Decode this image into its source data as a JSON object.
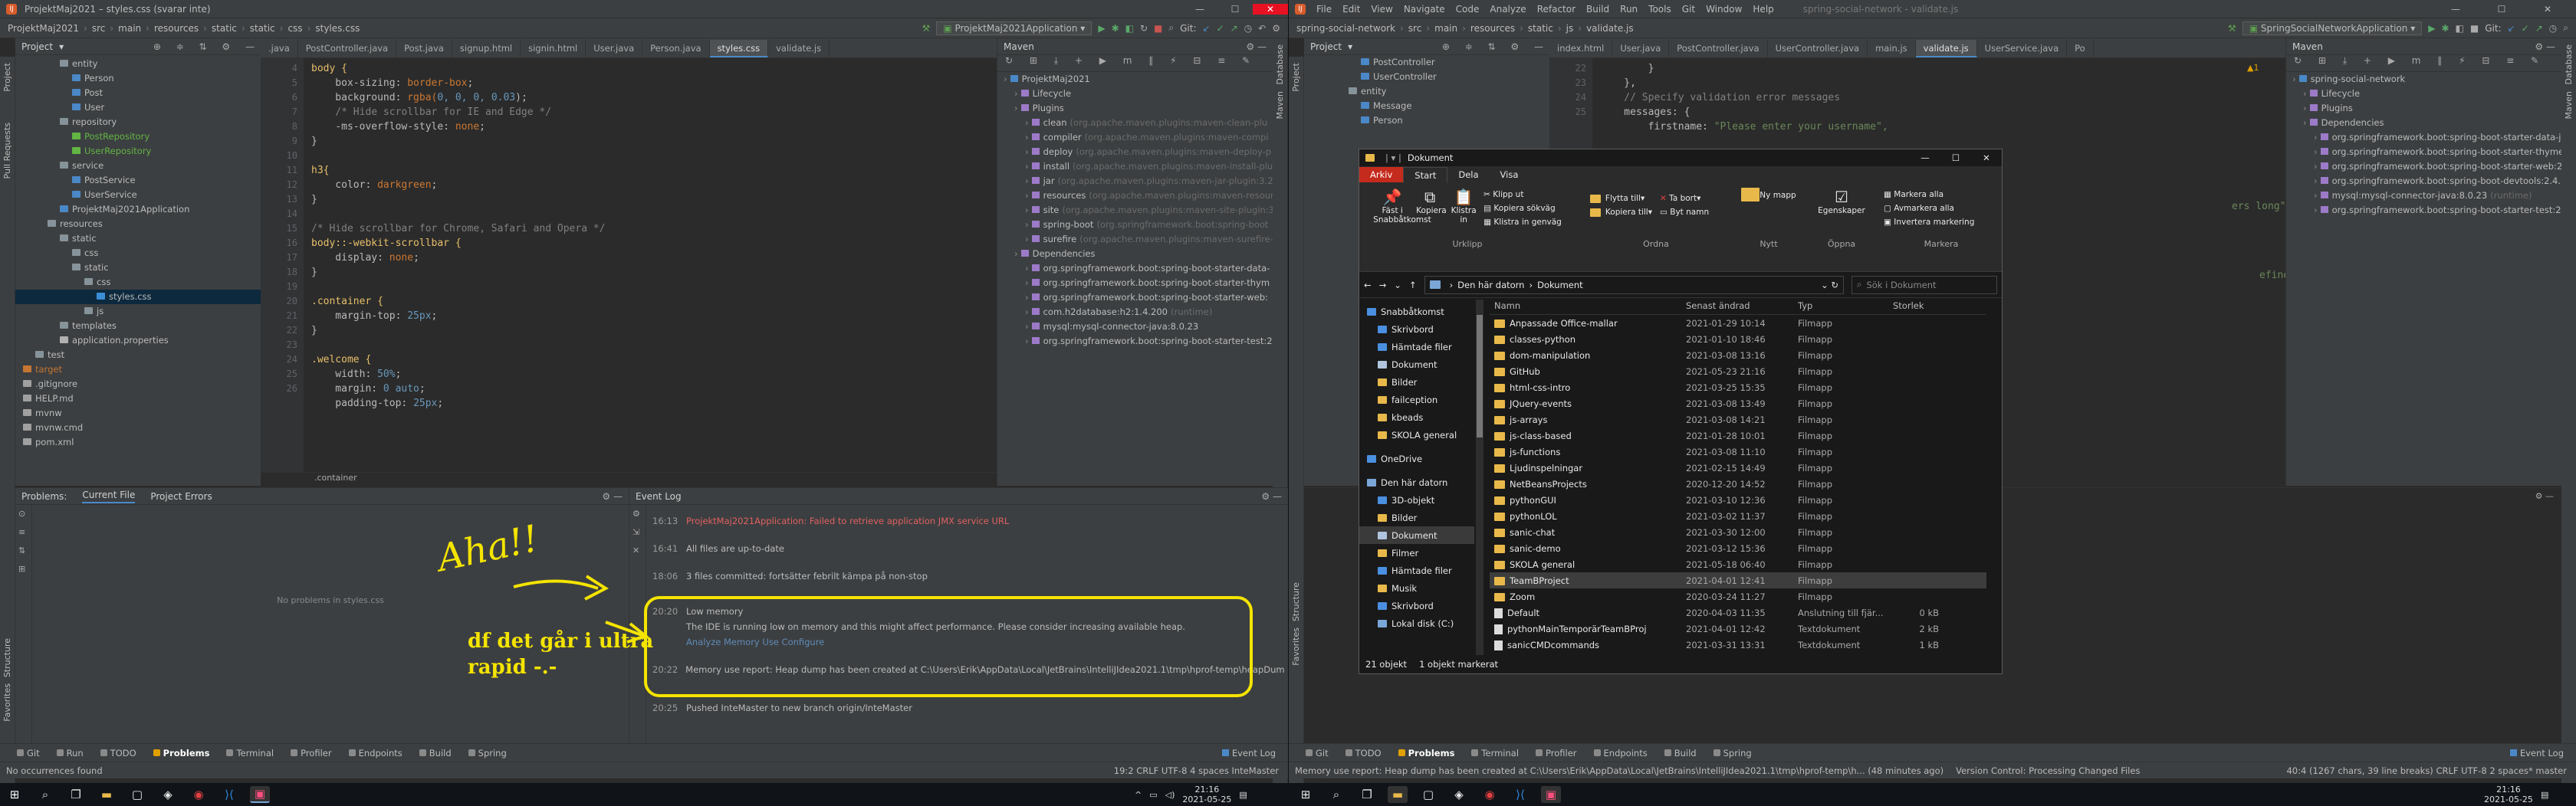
{
  "left_ide": {
    "title": "ProjektMaj2021 – styles.css (svarar inte)",
    "menu": [
      "File",
      "Edit",
      "View",
      "Navigate",
      "Code",
      "Analyze",
      "Refactor",
      "Build",
      "Run",
      "Tools",
      "Git",
      "Window",
      "Help"
    ],
    "breadcrumb": [
      "ProjektMaj2021",
      "src",
      "main",
      "resources",
      "static",
      "static",
      "css",
      "styles.css"
    ],
    "run_config": "ProjektMaj2021Application",
    "git_label": "Git:",
    "tabs": [
      ".java",
      "PostController.java",
      "Post.java",
      "signup.html",
      "signin.html",
      "User.java",
      "Person.java",
      "styles.css",
      "validate.js"
    ],
    "project_label": "Project",
    "tree": [
      {
        "t": "entity",
        "lvl": 3,
        "k": "folder"
      },
      {
        "t": "Person",
        "lvl": 4,
        "k": "class"
      },
      {
        "t": "Post",
        "lvl": 4,
        "k": "class"
      },
      {
        "t": "User",
        "lvl": 4,
        "k": "class"
      },
      {
        "t": "repository",
        "lvl": 3,
        "k": "folder"
      },
      {
        "t": "PostRepository",
        "lvl": 4,
        "k": "iface"
      },
      {
        "t": "UserRepository",
        "lvl": 4,
        "k": "iface"
      },
      {
        "t": "service",
        "lvl": 3,
        "k": "folder"
      },
      {
        "t": "PostService",
        "lvl": 4,
        "k": "class"
      },
      {
        "t": "UserService",
        "lvl": 4,
        "k": "class"
      },
      {
        "t": "ProjektMaj2021Application",
        "lvl": 3,
        "k": "class"
      },
      {
        "t": "resources",
        "lvl": 2,
        "k": "folder"
      },
      {
        "t": "static",
        "lvl": 3,
        "k": "folder"
      },
      {
        "t": "css",
        "lvl": 4,
        "k": "folder"
      },
      {
        "t": "static",
        "lvl": 4,
        "k": "folder"
      },
      {
        "t": "css",
        "lvl": 5,
        "k": "folder"
      },
      {
        "t": "styles.css",
        "lvl": 6,
        "k": "css"
      },
      {
        "t": "js",
        "lvl": 5,
        "k": "folder"
      },
      {
        "t": "templates",
        "lvl": 3,
        "k": "folder"
      },
      {
        "t": "application.properties",
        "lvl": 3,
        "k": "prop"
      },
      {
        "t": "test",
        "lvl": 1,
        "k": "folder"
      },
      {
        "t": "target",
        "lvl": 0,
        "k": "folder-ex"
      },
      {
        "t": ".gitignore",
        "lvl": 0,
        "k": "file"
      },
      {
        "t": "HELP.md",
        "lvl": 0,
        "k": "file"
      },
      {
        "t": "mvnw",
        "lvl": 0,
        "k": "file"
      },
      {
        "t": "mvnw.cmd",
        "lvl": 0,
        "k": "file"
      },
      {
        "t": "pom.xml",
        "lvl": 0,
        "k": "file"
      }
    ],
    "gutter": [
      "4",
      "5",
      "6",
      "7",
      "8",
      "9",
      "10",
      "11",
      "12",
      "13",
      "14",
      "15",
      "16",
      "17",
      "18",
      "19",
      "20",
      "21",
      "22",
      "23",
      "24",
      "25",
      "26"
    ],
    "code_lines": [
      [
        [
          "body {",
          "sel"
        ]
      ],
      [
        [
          "    box-sizing: ",
          "p"
        ],
        [
          "border-box",
          "k"
        ],
        [
          ";",
          "p"
        ]
      ],
      [
        [
          "    background: ",
          "p"
        ],
        [
          "rgba(",
          "k"
        ],
        [
          "0, 0, 0, 0.03",
          "n"
        ],
        [
          ");",
          "p"
        ]
      ],
      [
        [
          "    /* Hide scrollbar for IE and Edge */",
          "c"
        ]
      ],
      [
        [
          "    -ms-overflow-style: ",
          "p"
        ],
        [
          "none",
          "k"
        ],
        [
          ";",
          "p"
        ]
      ],
      [
        [
          "}",
          "p"
        ]
      ],
      [
        [
          "",
          "p"
        ]
      ],
      [
        [
          "h3{",
          "sel"
        ]
      ],
      [
        [
          "    color: ",
          "p"
        ],
        [
          "darkgreen",
          "k"
        ],
        [
          ";",
          "p"
        ]
      ],
      [
        [
          "}",
          "p"
        ]
      ],
      [
        [
          "",
          "p"
        ]
      ],
      [
        [
          "/* Hide scrollbar for Chrome, Safari and Opera */",
          "c"
        ]
      ],
      [
        [
          "body::-webkit-scrollbar {",
          "sel"
        ]
      ],
      [
        [
          "    display: ",
          "p"
        ],
        [
          "none",
          "k"
        ],
        [
          ";",
          "p"
        ]
      ],
      [
        [
          "}",
          "p"
        ]
      ],
      [
        [
          "",
          "p"
        ]
      ],
      [
        [
          ".container {",
          "sel"
        ]
      ],
      [
        [
          "    margin-top: ",
          "p"
        ],
        [
          "25px",
          "n"
        ],
        [
          ";",
          "p"
        ]
      ],
      [
        [
          "}",
          "p"
        ]
      ],
      [
        [
          "",
          "p"
        ]
      ],
      [
        [
          ".welcome {",
          "sel"
        ]
      ],
      [
        [
          "    width: ",
          "p"
        ],
        [
          "50%",
          "n"
        ],
        [
          ";",
          "p"
        ]
      ],
      [
        [
          "    margin: ",
          "p"
        ],
        [
          "0 auto",
          "n"
        ],
        [
          ";",
          "p"
        ]
      ],
      [
        [
          "    padding-top: ",
          "p"
        ],
        [
          "25px",
          "n"
        ],
        [
          ";",
          "p"
        ]
      ]
    ],
    "editor_crumb": ".container",
    "maven_label": "Maven",
    "maven_tree": [
      {
        "t": "ProjektMaj2021",
        "lvl": 0
      },
      {
        "t": "Lifecycle",
        "lvl": 1
      },
      {
        "t": "Plugins",
        "lvl": 1
      },
      {
        "t": "clean",
        "d": "(org.apache.maven.plugins:maven-clean-plu",
        "lvl": 2
      },
      {
        "t": "compiler",
        "d": "(org.apache.maven.plugins:maven-compi",
        "lvl": 2
      },
      {
        "t": "deploy",
        "d": "(org.apache.maven.plugins:maven-deploy-p",
        "lvl": 2
      },
      {
        "t": "install",
        "d": "(org.apache.maven.plugins:maven-install-plu",
        "lvl": 2
      },
      {
        "t": "jar",
        "d": "(org.apache.maven.plugins:maven-jar-plugin:3.2",
        "lvl": 2
      },
      {
        "t": "resources",
        "d": "(org.apache.maven.plugins:maven-resour",
        "lvl": 2
      },
      {
        "t": "site",
        "d": "(org.apache.maven.plugins:maven-site-plugin:3",
        "lvl": 2
      },
      {
        "t": "spring-boot",
        "d": "(org.springframework.boot:spring-boot",
        "lvl": 2
      },
      {
        "t": "surefire",
        "d": "(org.apache.maven.plugins:maven-surefire-",
        "lvl": 2
      },
      {
        "t": "Dependencies",
        "lvl": 1
      },
      {
        "t": "org.springframework.boot:spring-boot-starter-data-",
        "lvl": 2
      },
      {
        "t": "org.springframework.boot:spring-boot-starter-thym",
        "lvl": 2
      },
      {
        "t": "org.springframework.boot:spring-boot-starter-web:",
        "lvl": 2
      },
      {
        "t": "com.h2database:h2:1.4.200",
        "d": "(runtime)",
        "lvl": 2
      },
      {
        "t": "mysql:mysql-connector-java:8.0.23",
        "lvl": 2
      },
      {
        "t": "org.springframework.boot:spring-boot-starter-test:2",
        "lvl": 2
      }
    ],
    "problems_tabs": [
      "Problems:",
      "Current File",
      "Project Errors"
    ],
    "problems_empty": "No problems in styles.css",
    "event_log_label": "Event Log",
    "events": [
      {
        "time": "16:13",
        "text": "ProjektMaj2021Application: Failed to retrieve application JMX service URL",
        "err": true
      },
      {
        "time": "16:41",
        "text": "All files are up-to-date",
        "err": false
      },
      {
        "time": "18:06",
        "text": "3 files committed: fortsätter febrilt kämpa på non-stop",
        "err": false
      },
      {
        "time": "20:20",
        "text": "Low memory",
        "err": false
      },
      {
        "time": "",
        "text": "The IDE is running low on memory and this might affect performance. Please consider increasing available heap.",
        "err": false
      },
      {
        "time": "",
        "text": "Analyze Memory Use   Configure",
        "err": false,
        "link": true
      },
      {
        "time": "20:22",
        "text": "Memory use report: Heap dump has been created at C:\\Users\\Erik\\AppData\\Local\\JetBrains\\IntelliJIdea2021.1\\tmp\\hprof-temp\\heapDump-idea",
        "err": false
      },
      {
        "time": "20:25",
        "text": "Pushed InteMaster to new branch origin/InteMaster",
        "err": false
      }
    ],
    "toolwin": [
      "Git",
      "Run",
      "TODO",
      "Problems",
      "Terminal",
      "Profiler",
      "Endpoints",
      "Build",
      "Spring"
    ],
    "toolwin_right": "Event Log",
    "status_left": "No occurrences found",
    "status_right": "19:2  CRLF  UTF-8  4 spaces  InteMaster"
  },
  "annotation": {
    "aha": "Aha!!",
    "line1": "df det går i ultra",
    "line2": "rapid -.-"
  },
  "right_ide": {
    "menu": [
      "File",
      "Edit",
      "View",
      "Navigate",
      "Code",
      "Analyze",
      "Refactor",
      "Build",
      "Run",
      "Tools",
      "Git",
      "Window",
      "Help"
    ],
    "title_ghost": "spring-social-network - validate.js",
    "breadcrumb": [
      "spring-social-network",
      "src",
      "main",
      "resources",
      "static",
      "js",
      "validate.js"
    ],
    "run_config": "SpringSocialNetworkApplication",
    "git_label": "Git:",
    "tabs": [
      "index.html",
      "User.java",
      "PostController.java",
      "UserController.java",
      "main.js",
      "validate.js",
      "UserService.java",
      "Po"
    ],
    "tree": [
      {
        "t": "PostController",
        "lvl": 4,
        "k": "class"
      },
      {
        "t": "UserController",
        "lvl": 4,
        "k": "class"
      },
      {
        "t": "entity",
        "lvl": 3,
        "k": "folder"
      },
      {
        "t": "Message",
        "lvl": 4,
        "k": "class"
      },
      {
        "t": "Person",
        "lvl": 4,
        "k": "class"
      }
    ],
    "gutter": [
      "22",
      "23",
      "24",
      "25"
    ],
    "code_lines": [
      [
        [
          "        }",
          "p"
        ]
      ],
      [
        [
          "    },",
          "p"
        ]
      ],
      [
        [
          "    // Specify validation error messages",
          "c"
        ]
      ],
      [
        [
          "    messages: {",
          "p"
        ]
      ],
      [
        [
          "        firstname: ",
          "p"
        ],
        [
          "\"Please enter your username\",",
          "s"
        ]
      ]
    ],
    "peek1": "ers long\"",
    "peek2": "efined",
    "warn": "▲1",
    "maven_label": "Maven",
    "maven_tree": [
      {
        "t": "spring-social-network",
        "lvl": 0
      },
      {
        "t": "Lifecycle",
        "lvl": 1
      },
      {
        "t": "Plugins",
        "lvl": 1
      },
      {
        "t": "Dependencies",
        "lvl": 1
      },
      {
        "t": "org.springframework.boot:spring-boot-starter-data-jp",
        "lvl": 2
      },
      {
        "t": "org.springframework.boot:spring-boot-starter-thymel",
        "lvl": 2
      },
      {
        "t": "org.springframework.boot:spring-boot-starter-web:2.",
        "lvl": 2
      },
      {
        "t": "org.springframework.boot:spring-boot-devtools:2.4.5",
        "lvl": 2
      },
      {
        "t": "mysql:mysql-connector-java:8.0.23",
        "d": "(runtime)",
        "lvl": 2
      },
      {
        "t": "org.springframework.boot:spring-boot-starter-test:2.4",
        "lvl": 2
      }
    ],
    "toolwin": [
      "Git",
      "TODO",
      "Problems",
      "Terminal",
      "Profiler",
      "Endpoints",
      "Build",
      "Spring"
    ],
    "toolwin_right": "Event Log",
    "status_left": "Memory use report: Heap dump has been created at C:\\Users\\Erik\\AppData\\Local\\JetBrains\\IntelliJIdea2021.1\\tmp\\hprof-temp\\h... (48 minutes ago)",
    "status_mid": "Version Control: Processing Changed Files",
    "status_right": "40:4 (1267 chars, 39 line breaks)  CRLF  UTF-8  2 spaces*  master"
  },
  "explorer": {
    "title": "Dokument",
    "ribbon_tabs": [
      "Arkiv",
      "Start",
      "Dela",
      "Visa"
    ],
    "groups": [
      {
        "label": "Urklipp",
        "items": [
          "Fäst i Snabbåtkomst",
          "Kopiera",
          "Klistra in",
          "Klipp ut",
          "Kopiera sökväg",
          "Klistra in genväg"
        ]
      },
      {
        "label": "Ordna",
        "items": [
          "Flytta till",
          "Kopiera till",
          "Ta bort",
          "Byt namn"
        ]
      },
      {
        "label": "Nytt",
        "items": [
          "Ny mapp"
        ]
      },
      {
        "label": "Öppna",
        "items": [
          "Egenskaper"
        ]
      },
      {
        "label": "Markera",
        "items": [
          "Markera alla",
          "Avmarkera alla",
          "Invertera markering"
        ]
      }
    ],
    "address": [
      "Den här datorn",
      "Dokument"
    ],
    "search_placeholder": "Sök i Dokument",
    "nav": [
      {
        "t": "Snabbåtkomst",
        "i": "star"
      },
      {
        "t": "Skrivbord",
        "i": "blue"
      },
      {
        "t": "Hämtade filer",
        "i": "blue"
      },
      {
        "t": "Dokument",
        "i": "doc"
      },
      {
        "t": "Bilder",
        "i": "yel"
      },
      {
        "t": "failception",
        "i": "yel"
      },
      {
        "t": "kbeads",
        "i": "yel"
      },
      {
        "t": "SKOLA general",
        "i": "yel"
      },
      {
        "t": "OneDrive",
        "i": "blue"
      },
      {
        "t": "Den här datorn",
        "i": "pc"
      },
      {
        "t": "3D-objekt",
        "i": "blue"
      },
      {
        "t": "Bilder",
        "i": "yel"
      },
      {
        "t": "Dokument",
        "i": "doc"
      },
      {
        "t": "Filmer",
        "i": "yel"
      },
      {
        "t": "Hämtade filer",
        "i": "blue"
      },
      {
        "t": "Musik",
        "i": "yel"
      },
      {
        "t": "Skrivbord",
        "i": "blue"
      },
      {
        "t": "Lokal disk (C:)",
        "i": "pc"
      }
    ],
    "columns": [
      "Namn",
      "Senast ändrad",
      "Typ",
      "Storlek"
    ],
    "files": [
      [
        "Anpassade Office-mallar",
        "2021-01-29 10:14",
        "Filmapp",
        ""
      ],
      [
        "classes-python",
        "2021-01-10 18:46",
        "Filmapp",
        ""
      ],
      [
        "dom-manipulation",
        "2021-03-08 13:16",
        "Filmapp",
        ""
      ],
      [
        "GitHub",
        "2021-05-23 21:16",
        "Filmapp",
        ""
      ],
      [
        "html-css-intro",
        "2021-03-25 15:35",
        "Filmapp",
        ""
      ],
      [
        "JQuery-events",
        "2021-03-08 13:49",
        "Filmapp",
        ""
      ],
      [
        "js-arrays",
        "2021-03-08 14:21",
        "Filmapp",
        ""
      ],
      [
        "js-class-based",
        "2021-01-28 10:01",
        "Filmapp",
        ""
      ],
      [
        "js-functions",
        "2021-03-08 11:10",
        "Filmapp",
        ""
      ],
      [
        "Ljudinspelningar",
        "2021-02-15 14:49",
        "Filmapp",
        ""
      ],
      [
        "NetBeansProjects",
        "2020-12-20 14:52",
        "Filmapp",
        ""
      ],
      [
        "pythonGUI",
        "2021-03-10 12:36",
        "Filmapp",
        ""
      ],
      [
        "pythonLOL",
        "2021-03-02 11:37",
        "Filmapp",
        ""
      ],
      [
        "sanic-chat",
        "2021-03-30 12:00",
        "Filmapp",
        ""
      ],
      [
        "sanic-demo",
        "2021-03-12 15:36",
        "Filmapp",
        ""
      ],
      [
        "SKOLA general",
        "2021-05-18 06:40",
        "Filmapp",
        ""
      ],
      [
        "TeamBProject",
        "2021-04-01 12:41",
        "Filmapp",
        ""
      ],
      [
        "Zoom",
        "2020-03-24 11:27",
        "Filmapp",
        ""
      ],
      [
        "Default",
        "2020-04-03 11:35",
        "Anslutning till fjär...",
        "0 kB"
      ],
      [
        "pythonMainTemporärTeamBProj",
        "2021-04-01 12:42",
        "Textdokument",
        "2 kB"
      ],
      [
        "sanicCMDcommands",
        "2021-03-31 13:31",
        "Textdokument",
        "1 kB"
      ]
    ],
    "status": [
      "21 objekt",
      "1 objekt markerat"
    ]
  },
  "taskbar": {
    "time": "21:16",
    "date": "2021-05-25",
    "time2": "21:16",
    "date2": "2021-05-25"
  }
}
